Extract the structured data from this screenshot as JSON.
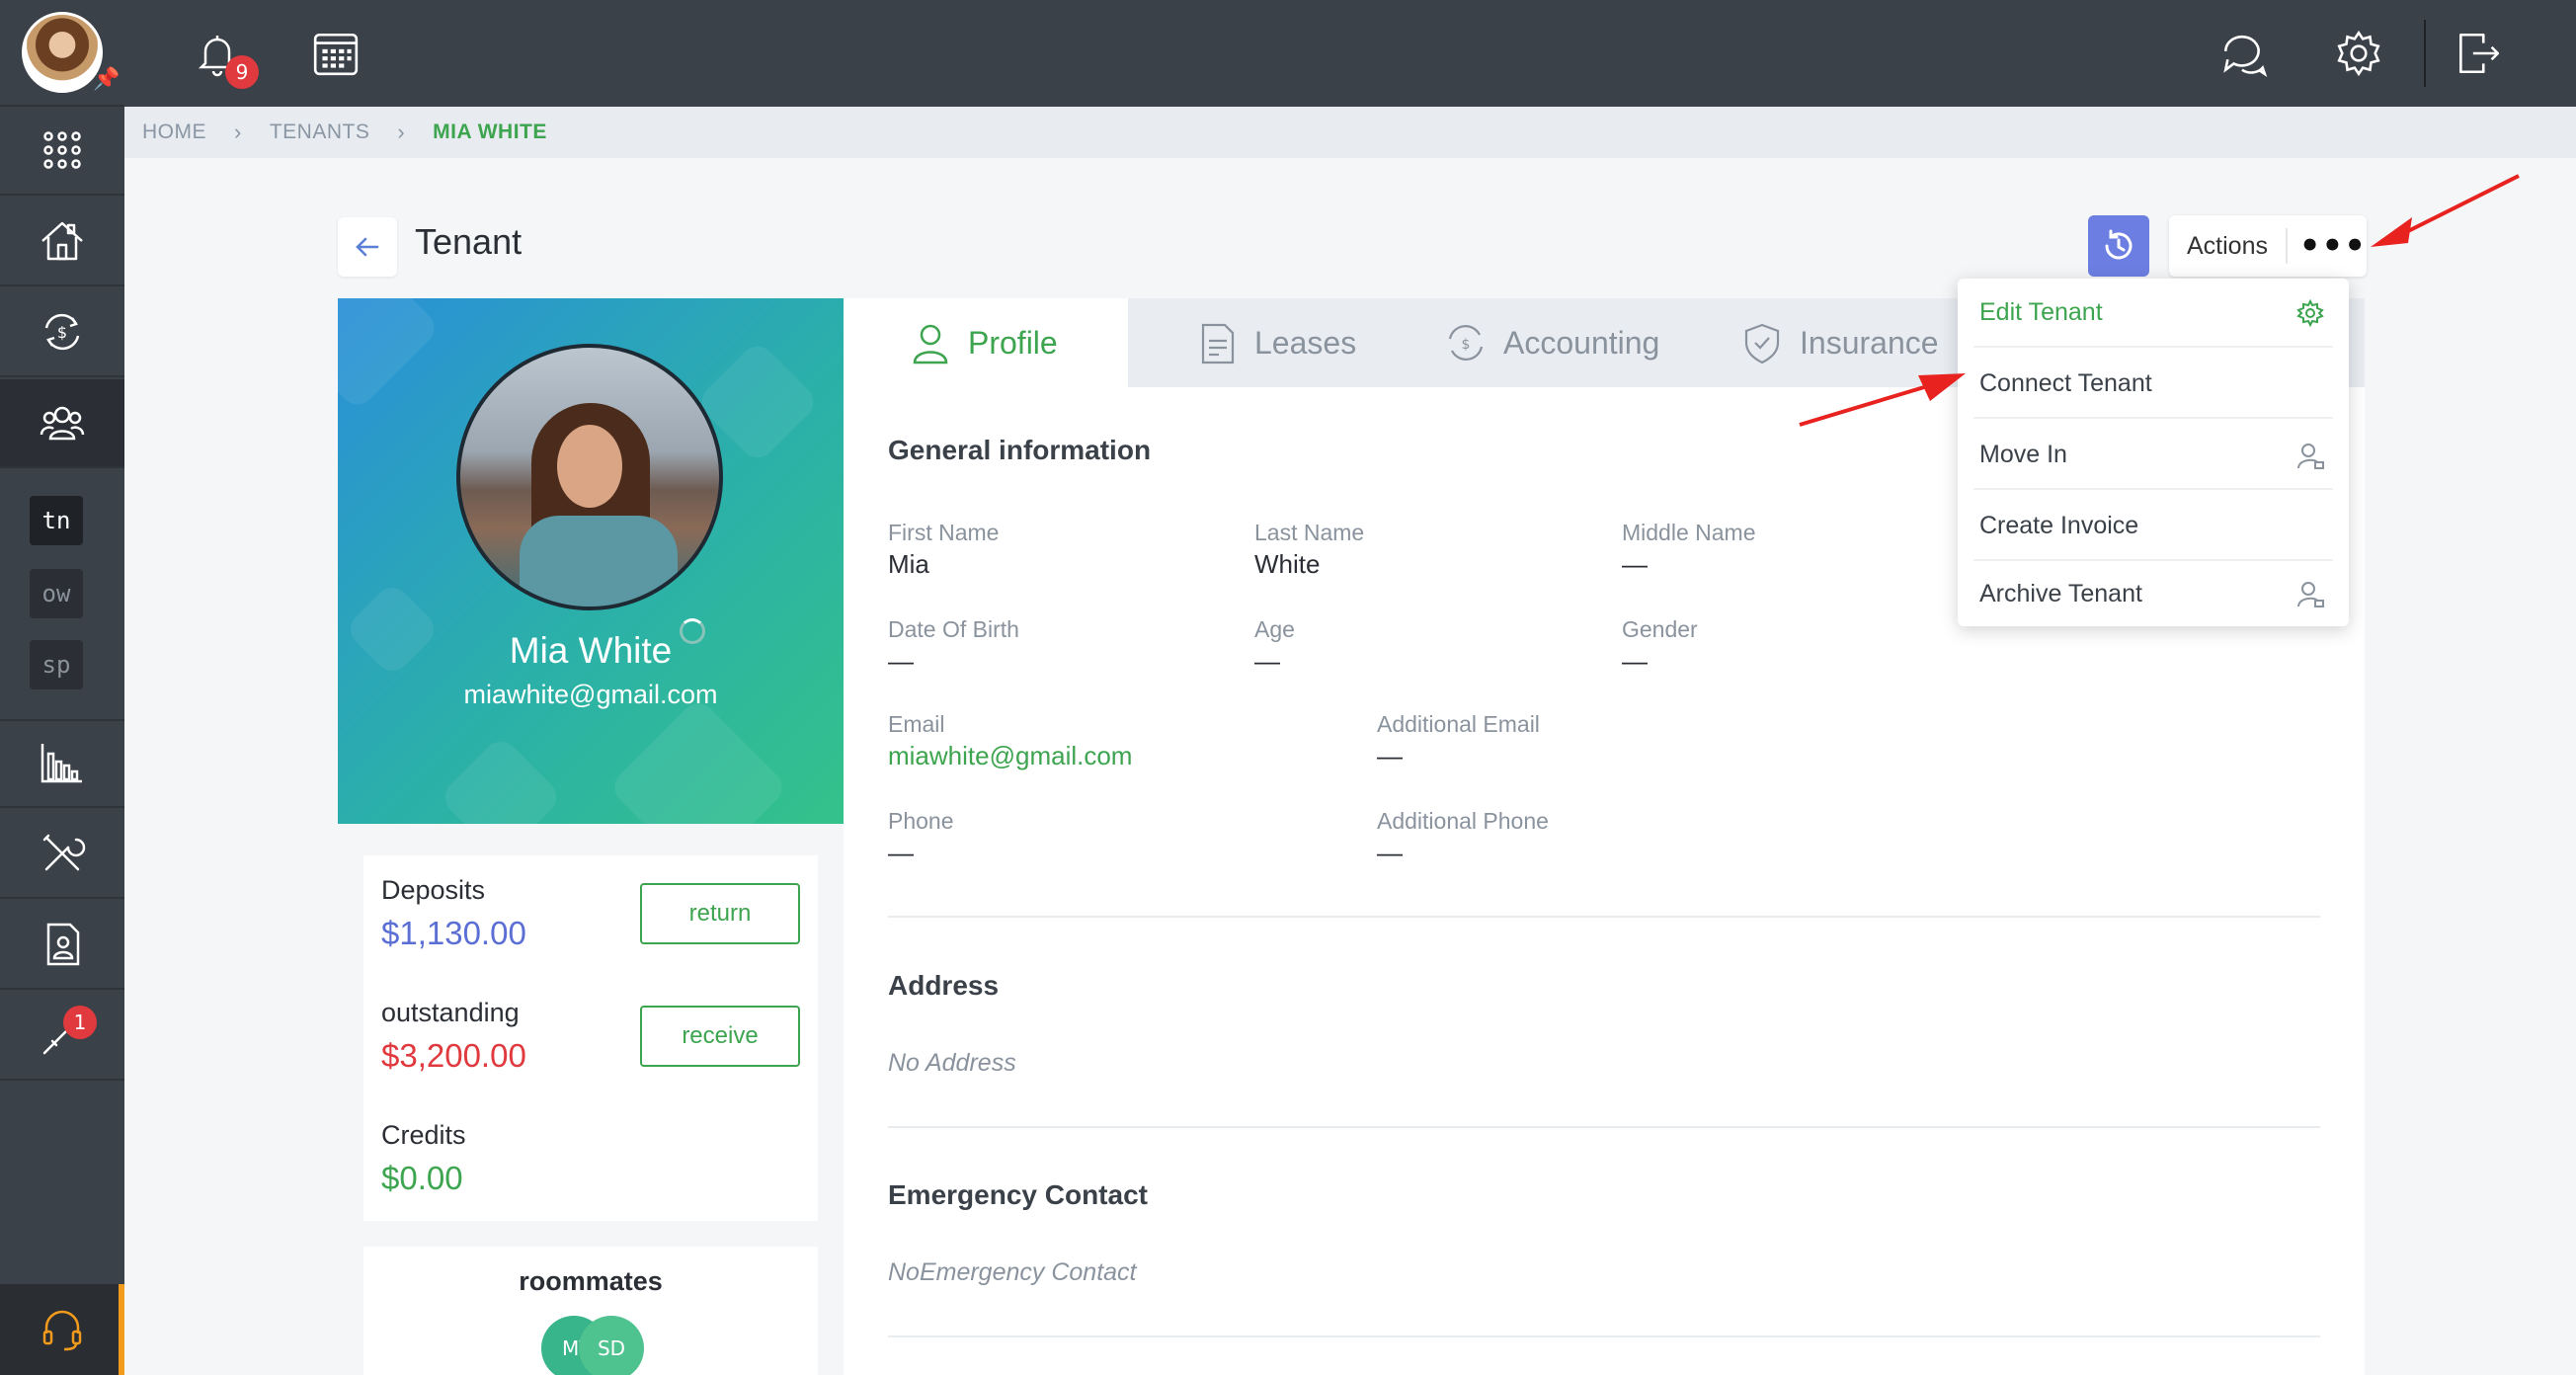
{
  "topbar": {
    "notifications_count": "9"
  },
  "sidebar": {
    "sub_items": [
      "tn",
      "ow",
      "sp"
    ],
    "tools_badge": "1"
  },
  "breadcrumb": {
    "home": "HOME",
    "tenants": "TENANTS",
    "current": "MIA WHITE"
  },
  "header": {
    "title": "Tenant",
    "actions_label": "Actions",
    "more_label": "•••"
  },
  "profile": {
    "name": "Mia White",
    "email": "miawhite@gmail.com"
  },
  "balances": {
    "deposits_label": "Deposits",
    "deposits_value": "$1,130.00",
    "return_label": "return",
    "outstanding_label": "outstanding",
    "outstanding_value": "$3,200.00",
    "receive_label": "receive",
    "credits_label": "Credits",
    "credits_value": "$0.00"
  },
  "roommates": {
    "title": "roommates",
    "avatars": [
      "M\\",
      "SD"
    ]
  },
  "tabs": [
    "Profile",
    "Leases",
    "Accounting",
    "Insurance"
  ],
  "general": {
    "title": "General information",
    "first_name_label": "First Name",
    "first_name": "Mia",
    "last_name_label": "Last Name",
    "last_name": "White",
    "middle_name_label": "Middle Name",
    "middle_name": "—",
    "dob_label": "Date Of Birth",
    "dob": "—",
    "age_label": "Age",
    "age": "—",
    "gender_label": "Gender",
    "gender": "—",
    "email_label": "Email",
    "email": "miawhite@gmail.com",
    "add_email_label": "Additional Email",
    "add_email": "—",
    "phone_label": "Phone",
    "phone": "—",
    "add_phone_label": "Additional Phone",
    "add_phone": "—"
  },
  "address": {
    "title": "Address",
    "note": "No Address"
  },
  "emergency": {
    "title": "Emergency Contact",
    "note": "NoEmergency Contact"
  },
  "dropdown": {
    "items": [
      "Edit Tenant",
      "Connect Tenant",
      "Move In",
      "Create Invoice",
      "Archive Tenant"
    ]
  },
  "colors": {
    "accent_green": "#3da44f",
    "sidebar": "#3b4149",
    "danger": "#e0393e",
    "primary_blue": "#6c7ee1",
    "deposit_blue": "#5b6ed4"
  }
}
